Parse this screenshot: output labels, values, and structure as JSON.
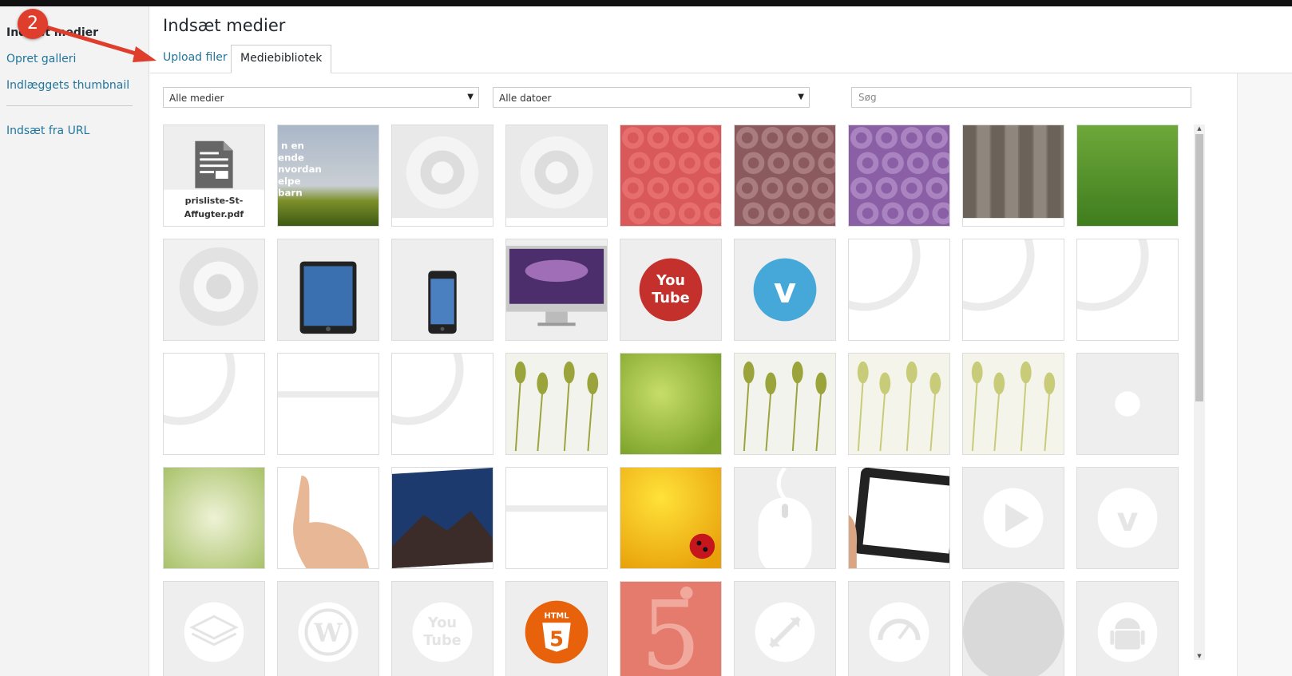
{
  "sidebar": {
    "current": "Indsæt medier",
    "links": [
      "Opret galleri",
      "Indlæggets thumbnail",
      "Indsæt fra URL"
    ]
  },
  "main": {
    "title": "Indsæt medier",
    "tabs": {
      "upload": "Upload filer",
      "library": "Mediebibliotek"
    }
  },
  "filters": {
    "type_select": "Alle medier",
    "date_select": "Alle datoer",
    "search_placeholder": "Søg"
  },
  "annotation": {
    "step_number": "2"
  },
  "media": {
    "pdf_name": "prisliste-St-Affugter.pdf",
    "tiles": [
      "pdf-document-icon",
      "text-landscape",
      "white-rose-watermark",
      "white-rose-watermark",
      "red-roses",
      "pink-roses",
      "purple-roses",
      "wood-planks",
      "green-grass",
      "white-flower",
      "ipad",
      "iphone",
      "imac",
      "youtube-logo",
      "vimeo-logo",
      "arc-shape",
      "arc-shape",
      "arc-shape",
      "arc-shape",
      "line-shape",
      "arc-shape",
      "wheat-stalks",
      "green-bokeh",
      "wheat-stalks",
      "wheat-stalks-blur",
      "wheat-stalks-blur",
      "white-dot",
      "green-bokeh-light",
      "hand-pointing",
      "mountain-night",
      "line-shape",
      "yellow-ladybug",
      "mouse-outline",
      "tablet-hand",
      "play-icon",
      "vimeo-icon",
      "layers-icon",
      "wordpress-icon",
      "youtube-icon",
      "html5-logo",
      "red-five",
      "expand-icon",
      "speedometer-icon",
      "gray-circle",
      "android-icon"
    ]
  }
}
